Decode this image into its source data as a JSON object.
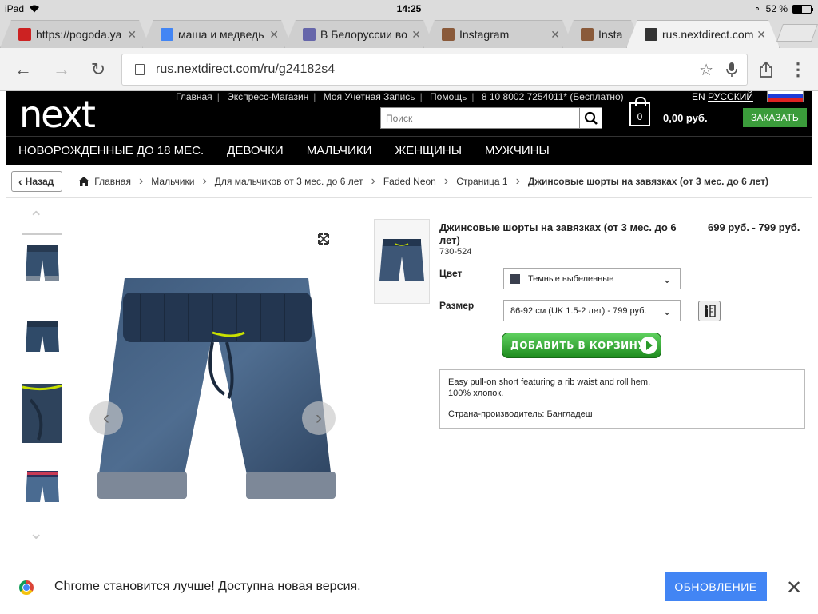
{
  "status_bar": {
    "device": "iPad",
    "time": "14:25",
    "battery": "52 %",
    "battery_level": 0.52
  },
  "tabs": [
    {
      "title": "https://pogoda.ya",
      "favicon_color": "#cc2222"
    },
    {
      "title": "маша и медведь",
      "favicon_color": "#4285f4"
    },
    {
      "title": "В Белоруссии во",
      "favicon_color": "#6666aa"
    },
    {
      "title": "Instagram",
      "favicon_color": "#8a5a3a"
    },
    {
      "title": "Insta",
      "favicon_color": "#8a5a3a"
    },
    {
      "title": "rus.nextdirect.com",
      "favicon_color": "#333333",
      "active": true
    }
  ],
  "toolbar": {
    "url": "rus.nextdirect.com/ru/g24182s4"
  },
  "site": {
    "logo": "next",
    "top_links": [
      "Главная",
      "Экспресс-Магазин",
      "Моя Учетная Запись",
      "Помощь",
      "8 10 8002 7254011* (Бесплатно)"
    ],
    "lang_en": "EN",
    "lang_ru": "РУССКИЙ",
    "search_placeholder": "Поиск",
    "bag_count": "0",
    "bag_total": "0,00 руб.",
    "order_label": "ЗАКАЗАТЬ",
    "nav": [
      "НОВОРОЖДЕННЫЕ ДО 18 МЕС.",
      "ДЕВОЧКИ",
      "МАЛЬЧИКИ",
      "ЖЕНЩИНЫ",
      "МУЖЧИНЫ"
    ],
    "back_label": "Назад",
    "breadcrumbs": [
      "Главная",
      "Мальчики",
      "Для мальчиков от 3 мес. до 6 лет",
      "Faded Neon",
      "Страница 1",
      "Джинсовые шорты на завязках (от 3 мес. до 6 лет)"
    ]
  },
  "product": {
    "title": "Джинсовые шорты на завязках (от 3 мес. до 6 лет)",
    "code": "730-524",
    "price": "699 руб. - 799 руб.",
    "color_label": "Цвет",
    "color_value": "Темные выбеленные",
    "size_label": "Размер",
    "size_value": "86-92 см (UK 1.5-2 лет) - 799 руб.",
    "add_to_cart": "ДОБАВИТЬ В КОРЗИНУ",
    "desc_line1": "Easy pull-on short featuring a rib waist and roll hem.",
    "desc_line2": "100% хлопок.",
    "desc_line3": "Страна-производитель: Бангладеш"
  },
  "infobar": {
    "message": "Chrome становится лучше! Доступна новая версия.",
    "button": "ОБНОВЛЕНИЕ"
  }
}
